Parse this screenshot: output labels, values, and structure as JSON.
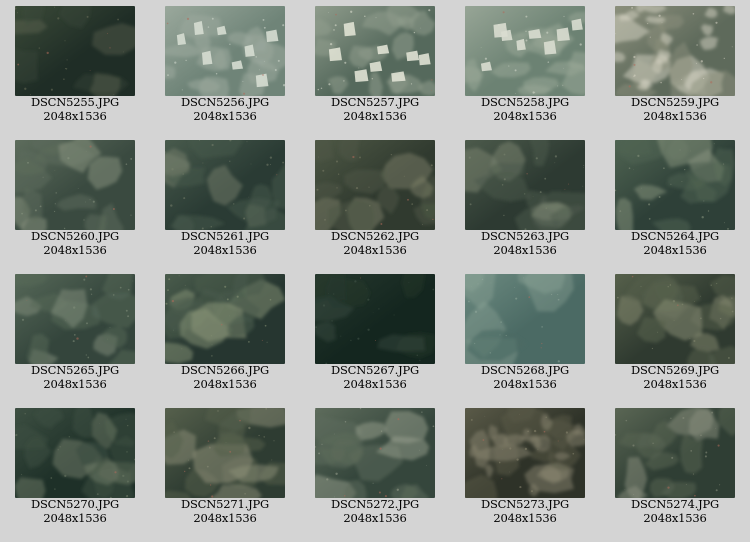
{
  "gallery": {
    "items": [
      {
        "filename": "DSCN5255.JPG",
        "dimensions": "2048x1536",
        "palette": {
          "base": "#1f2d26",
          "mid": "#3b4a38",
          "light": "#6b705a"
        },
        "scene": "dark-rock"
      },
      {
        "filename": "DSCN5256.JPG",
        "dimensions": "2048x1536",
        "palette": {
          "base": "#6f8478",
          "mid": "#9aa89c",
          "light": "#d6ddd2"
        },
        "scene": "blocks"
      },
      {
        "filename": "DSCN5257.JPG",
        "dimensions": "2048x1536",
        "palette": {
          "base": "#55695c",
          "mid": "#8f9c8c",
          "light": "#e0e2d4"
        },
        "scene": "blocks"
      },
      {
        "filename": "DSCN5258.JPG",
        "dimensions": "2048x1536",
        "palette": {
          "base": "#6c8273",
          "mid": "#97a596",
          "light": "#d9ddd0"
        },
        "scene": "blocks"
      },
      {
        "filename": "DSCN5259.JPG",
        "dimensions": "2048x1536",
        "palette": {
          "base": "#5e6a5b",
          "mid": "#8b8f7c",
          "light": "#d8d6c6"
        },
        "scene": "rubble"
      },
      {
        "filename": "DSCN5260.JPG",
        "dimensions": "2048x1536",
        "palette": {
          "base": "#3a4a40",
          "mid": "#5d6c5c",
          "light": "#8b9582"
        },
        "scene": "rock"
      },
      {
        "filename": "DSCN5261.JPG",
        "dimensions": "2048x1536",
        "palette": {
          "base": "#2a3b34",
          "mid": "#485a4c",
          "light": "#76806c"
        },
        "scene": "rock"
      },
      {
        "filename": "DSCN5262.JPG",
        "dimensions": "2048x1536",
        "palette": {
          "base": "#303a2f",
          "mid": "#4e5845",
          "light": "#7d8068"
        },
        "scene": "rock"
      },
      {
        "filename": "DSCN5263.JPG",
        "dimensions": "2048x1536",
        "palette": {
          "base": "#2d3a32",
          "mid": "#4c5a4b",
          "light": "#7c8571"
        },
        "scene": "rock"
      },
      {
        "filename": "DSCN5264.JPG",
        "dimensions": "2048x1536",
        "palette": {
          "base": "#2e4038",
          "mid": "#506452",
          "light": "#8a9680"
        },
        "scene": "rock"
      },
      {
        "filename": "DSCN5265.JPG",
        "dimensions": "2048x1536",
        "palette": {
          "base": "#34453c",
          "mid": "#566858",
          "light": "#848f7c"
        },
        "scene": "rock"
      },
      {
        "filename": "DSCN5266.JPG",
        "dimensions": "2048x1536",
        "palette": {
          "base": "#263630",
          "mid": "#4a5c4c",
          "light": "#8a9678"
        },
        "scene": "boulder"
      },
      {
        "filename": "DSCN5267.JPG",
        "dimensions": "2048x1536",
        "palette": {
          "base": "#14261f",
          "mid": "#26382e",
          "light": "#45574a"
        },
        "scene": "dark-rock"
      },
      {
        "filename": "DSCN5268.JPG",
        "dimensions": "2048x1536",
        "palette": {
          "base": "#4b6a64",
          "mid": "#6c8a80",
          "light": "#93aa9c"
        },
        "scene": "haze"
      },
      {
        "filename": "DSCN5269.JPG",
        "dimensions": "2048x1536",
        "palette": {
          "base": "#2f3a30",
          "mid": "#56604b",
          "light": "#878c72"
        },
        "scene": "boulder"
      },
      {
        "filename": "DSCN5270.JPG",
        "dimensions": "2048x1536",
        "palette": {
          "base": "#1e3028",
          "mid": "#3d4f42",
          "light": "#6d7a66"
        },
        "scene": "boulder"
      },
      {
        "filename": "DSCN5271.JPG",
        "dimensions": "2048x1536",
        "palette": {
          "base": "#2e3c32",
          "mid": "#56604c",
          "light": "#8e9078"
        },
        "scene": "boulder"
      },
      {
        "filename": "DSCN5272.JPG",
        "dimensions": "2048x1536",
        "palette": {
          "base": "#35463c",
          "mid": "#5e6c5c",
          "light": "#9aa290"
        },
        "scene": "rock"
      },
      {
        "filename": "DSCN5273.JPG",
        "dimensions": "2048x1536",
        "palette": {
          "base": "#2e3228",
          "mid": "#5a5a48",
          "light": "#8a8670"
        },
        "scene": "rubble"
      },
      {
        "filename": "DSCN5274.JPG",
        "dimensions": "2048x1536",
        "palette": {
          "base": "#2f3e34",
          "mid": "#5a6654",
          "light": "#8c9280"
        },
        "scene": "rock"
      }
    ]
  }
}
